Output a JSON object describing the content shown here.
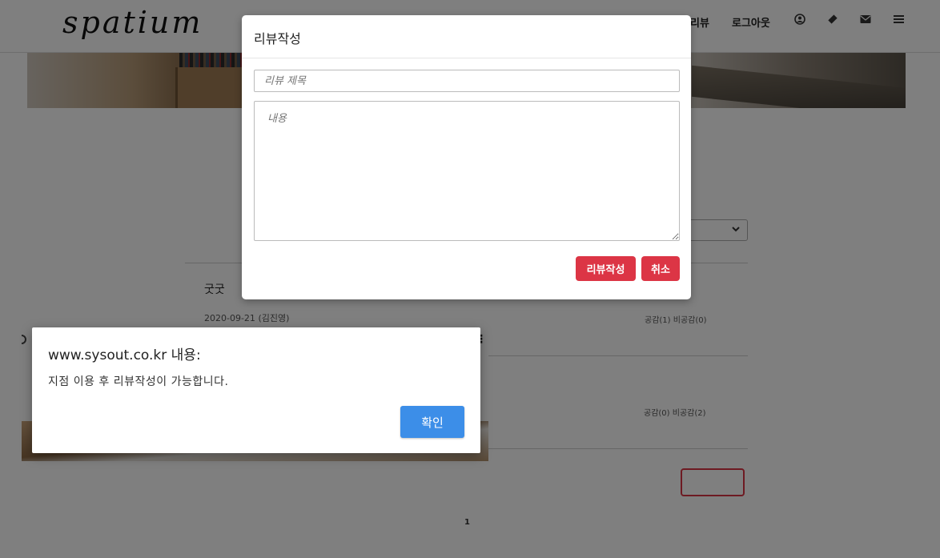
{
  "header": {
    "logo": "spatium",
    "nav": {
      "review": "리뷰",
      "logout": "로그아웃"
    },
    "icons": [
      "user-circle-icon",
      "ticket-icon",
      "envelope-icon",
      "menu-icon"
    ]
  },
  "reviews": [
    {
      "title": "굿굿",
      "date": "2020-09-21",
      "author": "(김진영)",
      "likes": "공감(1) 비공감(0)"
    },
    {
      "likes": "공감(0) 비공감(2)"
    }
  ],
  "pagination": {
    "current": "1"
  },
  "modal": {
    "title": "리뷰작성",
    "title_placeholder": "리뷰 제목",
    "content_placeholder": "내용",
    "submit": "리뷰작성",
    "cancel": "취소",
    "accent": "#dc3545"
  },
  "alert": {
    "title": "www.sysout.co.kr 내용:",
    "message": "지점 이용 후 리뷰작성이 가능합니다.",
    "ok": "확인",
    "accent": "#3c8ee8"
  }
}
